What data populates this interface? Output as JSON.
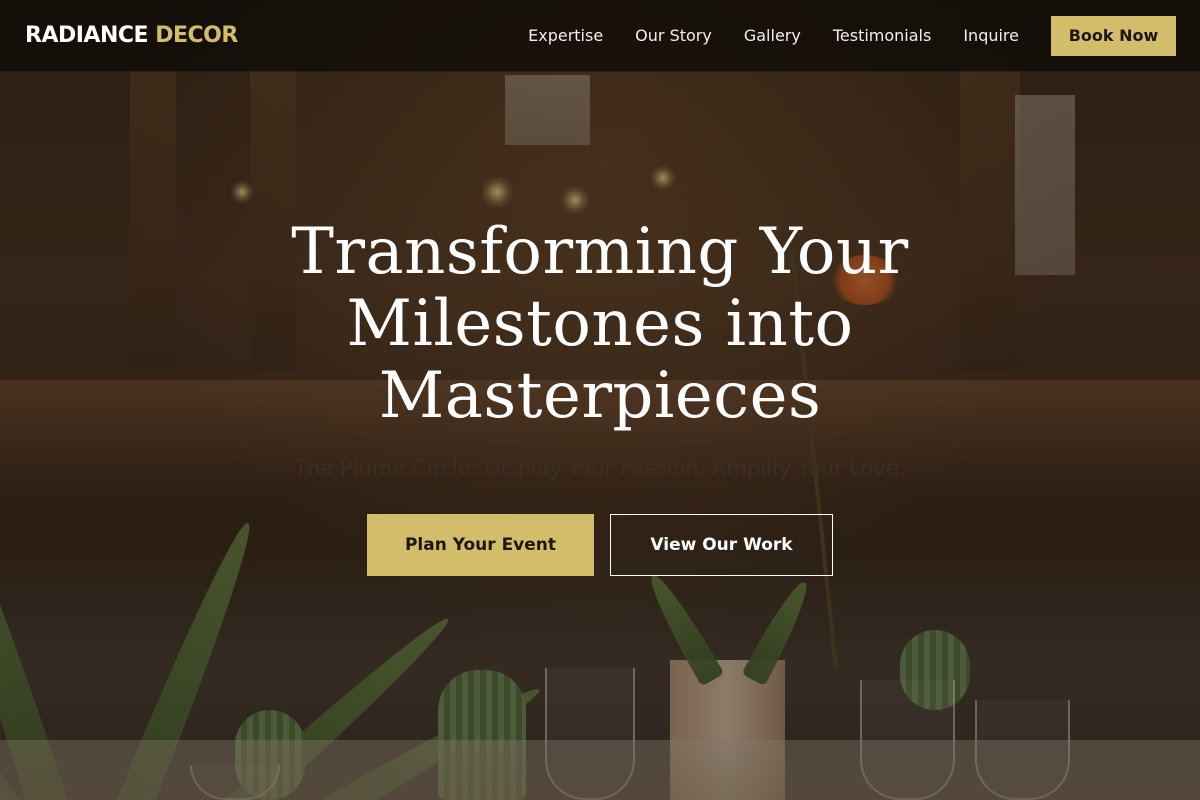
{
  "brand": {
    "name_primary": "RADIANCE",
    "name_accent": "DECOR"
  },
  "nav": {
    "links": [
      {
        "label": "Expertise"
      },
      {
        "label": "Our Story"
      },
      {
        "label": "Gallery"
      },
      {
        "label": "Testimonials"
      },
      {
        "label": "Inquire"
      }
    ],
    "cta_label": "Book Now"
  },
  "hero": {
    "title": "Transforming Your Milestones into Masterpieces",
    "subtitle": "The Plume Circle: Display Your Passion, Amplify Your Love.",
    "primary_cta": "Plan Your Event",
    "secondary_cta": "View Our Work",
    "background_image": "restaurant-dining-hall-photo"
  },
  "colors": {
    "accent_gold": "#d4bd6a",
    "nav_bg": "#100c08",
    "text_light": "#ffffff"
  }
}
